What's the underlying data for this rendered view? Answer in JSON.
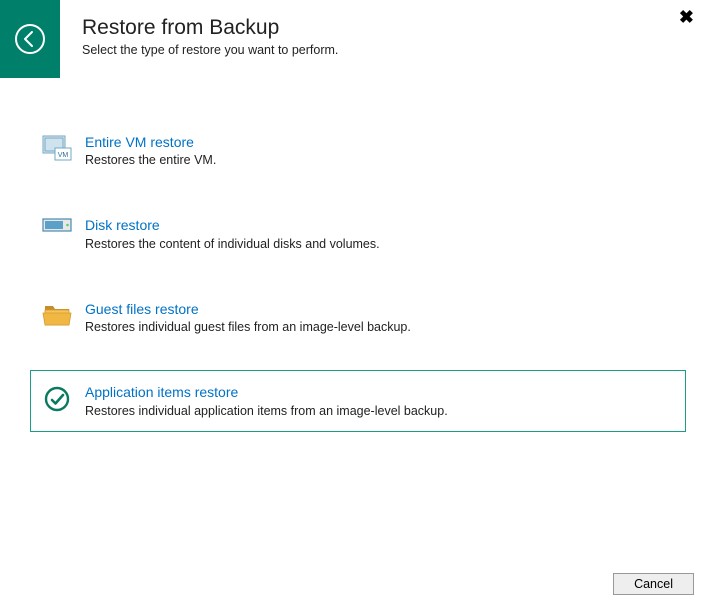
{
  "header": {
    "title": "Restore from Backup",
    "subtitle": "Select the type of restore you want to perform."
  },
  "options": [
    {
      "title": "Entire VM restore",
      "desc": "Restores the entire VM.",
      "icon": "vm-icon",
      "selected": false
    },
    {
      "title": "Disk restore",
      "desc": "Restores the content of individual disks and volumes.",
      "icon": "disk-icon",
      "selected": false
    },
    {
      "title": "Guest files restore",
      "desc": "Restores individual guest files from an image-level backup.",
      "icon": "folder-icon",
      "selected": false
    },
    {
      "title": "Application items restore",
      "desc": "Restores individual application items from an image-level backup.",
      "icon": "app-icon",
      "selected": true
    }
  ],
  "footer": {
    "cancel_label": "Cancel"
  }
}
